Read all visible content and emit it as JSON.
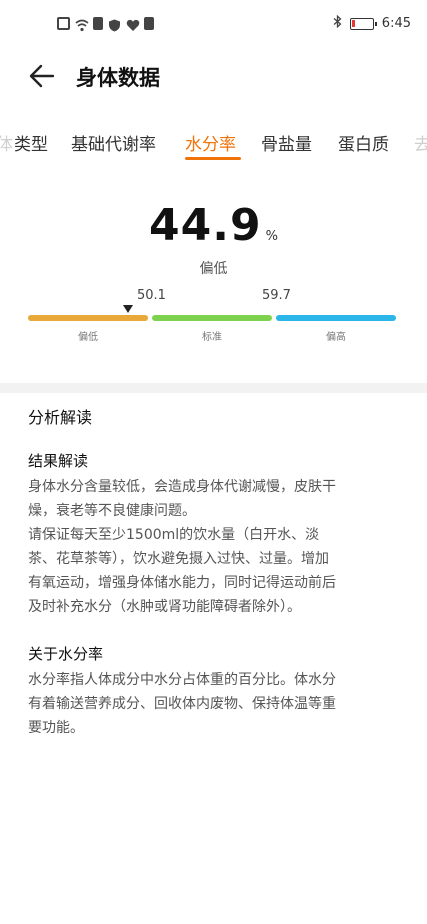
{
  "status_bar": {
    "time": "6:45",
    "icons_left": [
      "file-icon",
      "wifi-icon",
      "sim-icon",
      "shield-icon",
      "heart-icon",
      "notification-icon"
    ],
    "icons_right": [
      "bluetooth-icon",
      "battery-icon"
    ]
  },
  "header": {
    "title": "身体数据",
    "back_icon": "arrow-left-icon"
  },
  "tabs": [
    {
      "label": "类型",
      "active": false
    },
    {
      "label": "基础代谢率",
      "active": false
    },
    {
      "label": "水分率",
      "active": true
    },
    {
      "label": "骨盐量",
      "active": false
    },
    {
      "label": "蛋白质",
      "active": false
    }
  ],
  "tab_edge_left": "体",
  "tab_edge_right": "去",
  "metric": {
    "value": "44.9",
    "unit": "%",
    "level": "偏低"
  },
  "scale": {
    "thresholds": [
      "50.1",
      "59.7"
    ],
    "segments": [
      {
        "label": "偏低",
        "color": "#e8a83a"
      },
      {
        "label": "标准",
        "color": "#7ed14c"
      },
      {
        "label": "偏高",
        "color": "#2bb5e8"
      }
    ],
    "pointer_position": 0.83
  },
  "analysis": {
    "title": "分析解读",
    "result": {
      "title": "结果解读",
      "lines": [
        "身体水分含量较低，会造成身体代谢减慢，皮肤干",
        "燥，衰老等不良健康问题。",
        "请保证每天至少1500ml的饮水量（白开水、淡",
        "茶、花草茶等），饮水避免摄入过快、过量。增加",
        "有氧运动，增强身体储水能力，同时记得运动前后",
        "及时补充水分（水肿或肾功能障碍者除外）。"
      ]
    },
    "about": {
      "title": "关于水分率",
      "lines": [
        "水分率指人体成分中水分占体重的百分比。体水分",
        "有着输送营养成分、回收体内废物、保持体温等重",
        "要功能。"
      ]
    }
  }
}
